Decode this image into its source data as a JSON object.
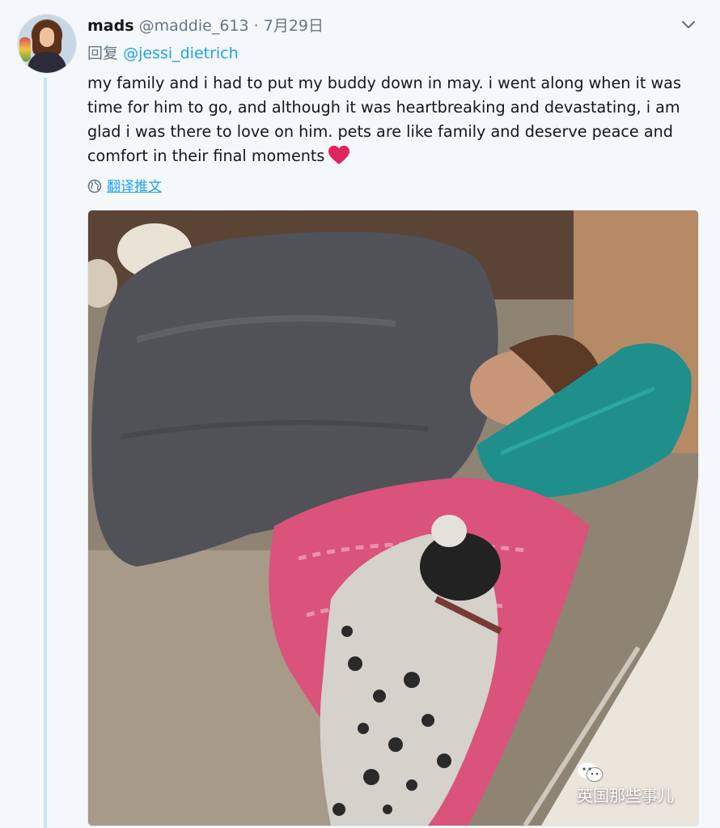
{
  "tweet": {
    "author_name": "mads",
    "author_handle": "@maddie_613",
    "separator": "·",
    "date": "7月29日",
    "reply_prefix": "回复",
    "reply_mention": "@jessi_dietrich",
    "text": "my family and i had to put my buddy down in may. i went along when it was time for him to go, and although it was heartbreaking and devastating, i am glad i was there to love on him. pets are like family and deserve peace and comfort in their final moments",
    "emoji": "red-heart-icon",
    "translate_label": "翻译推文"
  },
  "photo": {
    "watermark": "英国那些事儿"
  },
  "icons": {
    "chevron": "chevron-down-icon",
    "globe": "globe-icon",
    "wechat": "wechat-icon"
  },
  "colors": {
    "link": "#1da1f2",
    "secondary_text": "#657786",
    "thread_line": "#c4e4f7",
    "heart": "#e0245e"
  }
}
